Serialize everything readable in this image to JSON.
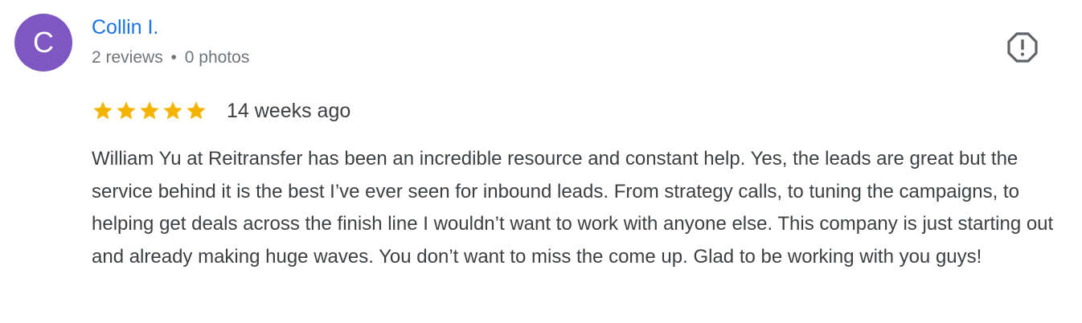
{
  "reviewer": {
    "avatar_letter": "C",
    "avatar_color": "#7e57c2",
    "name": "Collin I.",
    "reviews_count": "2 reviews",
    "separator": "•",
    "photos_count": "0 photos"
  },
  "rating": {
    "stars": 5,
    "max_stars": 5,
    "star_color": "#f4b400",
    "time_ago": "14 weeks ago"
  },
  "review": {
    "text": "William Yu at Reitransfer has been an incredible resource and constant help. Yes, the leads are great but the service behind it is the best I’ve ever seen for inbound leads. From strategy calls, to tuning the campaigns, to helping get deals across the finish line I wouldn’t want to work with anyone else. This company is just starting out and already making huge waves. You don’t want to miss the come up. Glad to be working with you guys!"
  },
  "icons": {
    "flag": "report-flag-icon",
    "star": "star-icon"
  },
  "colors": {
    "name_link": "#1a73e8",
    "meta_text": "#70757a",
    "body_text": "#3c4043",
    "icon_gray": "#5f6368"
  }
}
